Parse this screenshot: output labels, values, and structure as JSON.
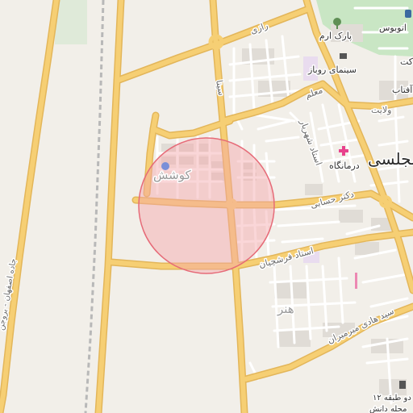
{
  "map": {
    "colors": {
      "background": "#f2efe9",
      "major_road": "#f6cf74",
      "major_road_casing": "#e3b65a",
      "minor_road": "#ffffff",
      "park": "#c9e6c4",
      "building": "#ddd9d3",
      "railway": "#b8b8b8",
      "highlight_fill": "#f5a3a9",
      "highlight_stroke": "#e66b78",
      "hospital": "#e8428d"
    },
    "highlight": {
      "shape": "circle",
      "label": ""
    },
    "labels": {
      "park": "پارک ارم",
      "bus": "اتوبوس",
      "cinema": "سینمای روباز",
      "road_razi": "رازی",
      "road_sina": "سینا",
      "road_moallem": "معلم",
      "road_velayat": "ولایت",
      "road_shahriar": "استاد شهریار",
      "clinic": "درمانگاه",
      "district_majlesi": "مجلسی",
      "district_kooshesh": "کوشش",
      "road_hesabi": "دکتر حسابی",
      "road_farshchian": "استاد فرشچیان",
      "district_honar": "هنر",
      "road_mirfendereski": "سید هادی میرمیران",
      "highway": "جاده اصفهان - بروجن",
      "bldg_two_floor": "دو طبقه ۱۲",
      "neighborhood_danesh": "محله دانش",
      "clip_kat": "کت",
      "clip_aftab": "آفتاب"
    },
    "icons": {
      "park": "tree-icon",
      "bus": "bus-icon",
      "cinema": "cinema-icon",
      "clinic": "hospital-cross-icon",
      "kooshesh": "pin-dot-icon",
      "two_floor": "building-icon"
    }
  }
}
